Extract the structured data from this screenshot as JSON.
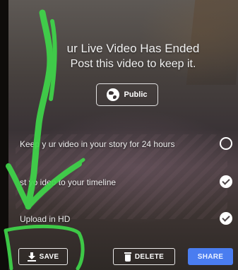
{
  "headline": {
    "line1": "ur Live Video Has Ended",
    "line2": "Post this video to keep it."
  },
  "privacy": {
    "label": "Public",
    "icon": "globe-icon"
  },
  "options": [
    {
      "label": "Keep y ur video in your story for 24 hours",
      "checked": false
    },
    {
      "label": "st yo  ideo to your timeline",
      "checked": true
    },
    {
      "label": "Upload in HD",
      "checked": true
    }
  ],
  "actions": {
    "save": "SAVE",
    "delete": "DELETE",
    "share": "SHARE"
  },
  "colors": {
    "share_button": "#4a7df0",
    "annotation_marker": "#3fd64a"
  }
}
